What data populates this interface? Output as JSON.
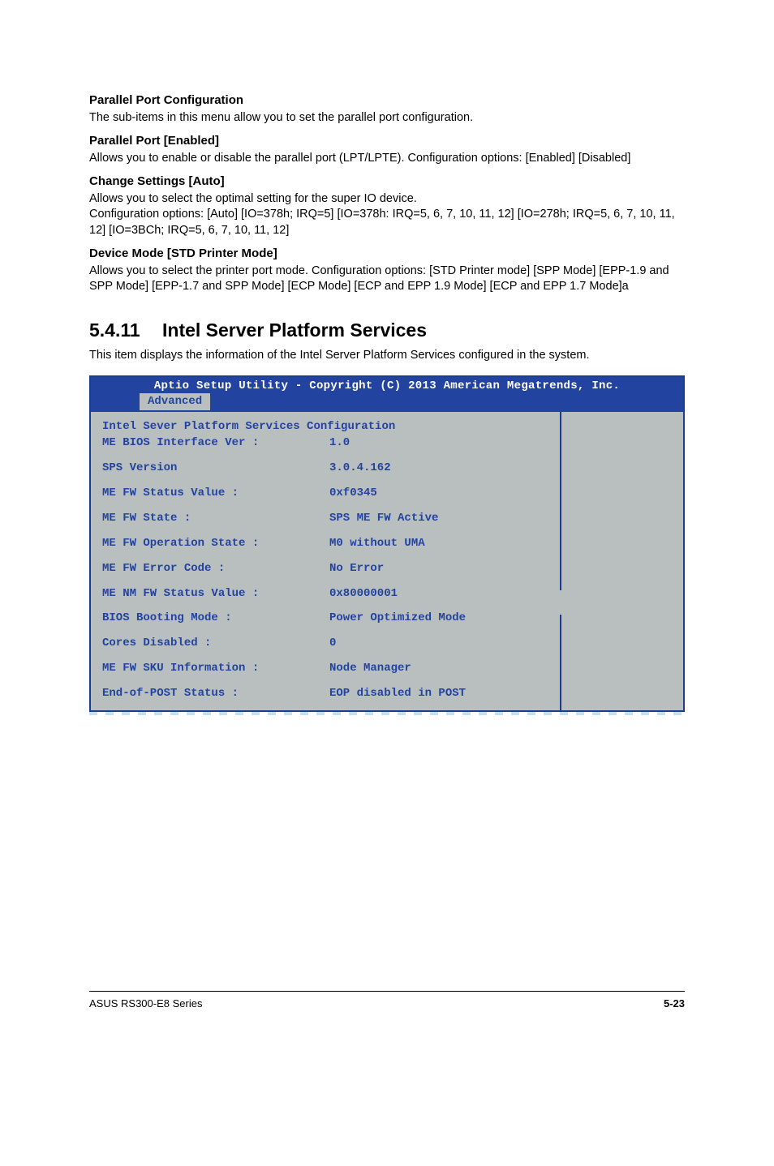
{
  "s1": {
    "h": "Parallel Port Configuration",
    "p": "The sub-items in this menu allow you to set the parallel port configuration.",
    "sub1h": "Parallel Port [Enabled]",
    "sub1p": "Allows you to enable or disable the parallel port (LPT/LPTE). Configuration options: [Enabled] [Disabled]",
    "sub2h": "Change Settings [Auto]",
    "sub2p1": "Allows you to select the optimal setting for the super IO device.",
    "sub2p2": "Configuration options: [Auto] [IO=378h; IRQ=5] [IO=378h: IRQ=5, 6, 7, 10, 11, 12] [IO=278h; IRQ=5, 6, 7, 10, 11, 12] [IO=3BCh; IRQ=5, 6, 7, 10, 11, 12]",
    "sub3h": "Device Mode [STD Printer Mode]",
    "sub3p": "Allows you to select the printer port mode. Configuration options: [STD Printer mode] [SPP Mode] [EPP-1.9 and SPP Mode] [EPP-1.7 and SPP Mode] [ECP Mode] [ECP and EPP 1.9 Mode] [ECP and EPP 1.7 Mode]a"
  },
  "section": {
    "num": "5.4.11",
    "title": "Intel Server Platform Services",
    "sub": "This item displays the information of the Intel Server Platform Services configured in the system."
  },
  "bios": {
    "title": "Aptio Setup Utility - Copyright (C) 2013 American Megatrends, Inc.",
    "tab": "Advanced",
    "rows": [
      {
        "k": "Intel Sever Platform Services Configuration",
        "v": ""
      },
      {
        "k": "ME BIOS Interface Ver :",
        "v": "1.0"
      },
      {
        "k": "",
        "v": ""
      },
      {
        "k": "SPS Version",
        "v": "3.0.4.162"
      },
      {
        "k": "",
        "v": ""
      },
      {
        "k": "ME FW Status Value    :",
        "v": "0xf0345"
      },
      {
        "k": "",
        "v": ""
      },
      {
        "k": "ME FW State           :",
        "v": "SPS ME FW Active"
      },
      {
        "k": "",
        "v": ""
      },
      {
        "k": "ME FW Operation State :",
        "v": "M0 without UMA"
      },
      {
        "k": "",
        "v": ""
      },
      {
        "k": "ME FW Error Code      :",
        "v": "No Error"
      },
      {
        "k": "",
        "v": ""
      },
      {
        "k": "ME NM FW Status Value :",
        "v": "0x80000001"
      },
      {
        "k": "",
        "v": ""
      },
      {
        "k": "BIOS Booting Mode     :",
        "v": "Power Optimized Mode"
      },
      {
        "k": "",
        "v": ""
      },
      {
        "k": "Cores Disabled        :",
        "v": "0"
      },
      {
        "k": "",
        "v": ""
      },
      {
        "k": "ME FW SKU Information :",
        "v": "Node Manager"
      },
      {
        "k": "",
        "v": ""
      },
      {
        "k": "End-of-POST Status    :",
        "v": "EOP disabled in POST"
      }
    ]
  },
  "footer": {
    "left": "ASUS RS300-E8 Series",
    "right": "5-23"
  }
}
